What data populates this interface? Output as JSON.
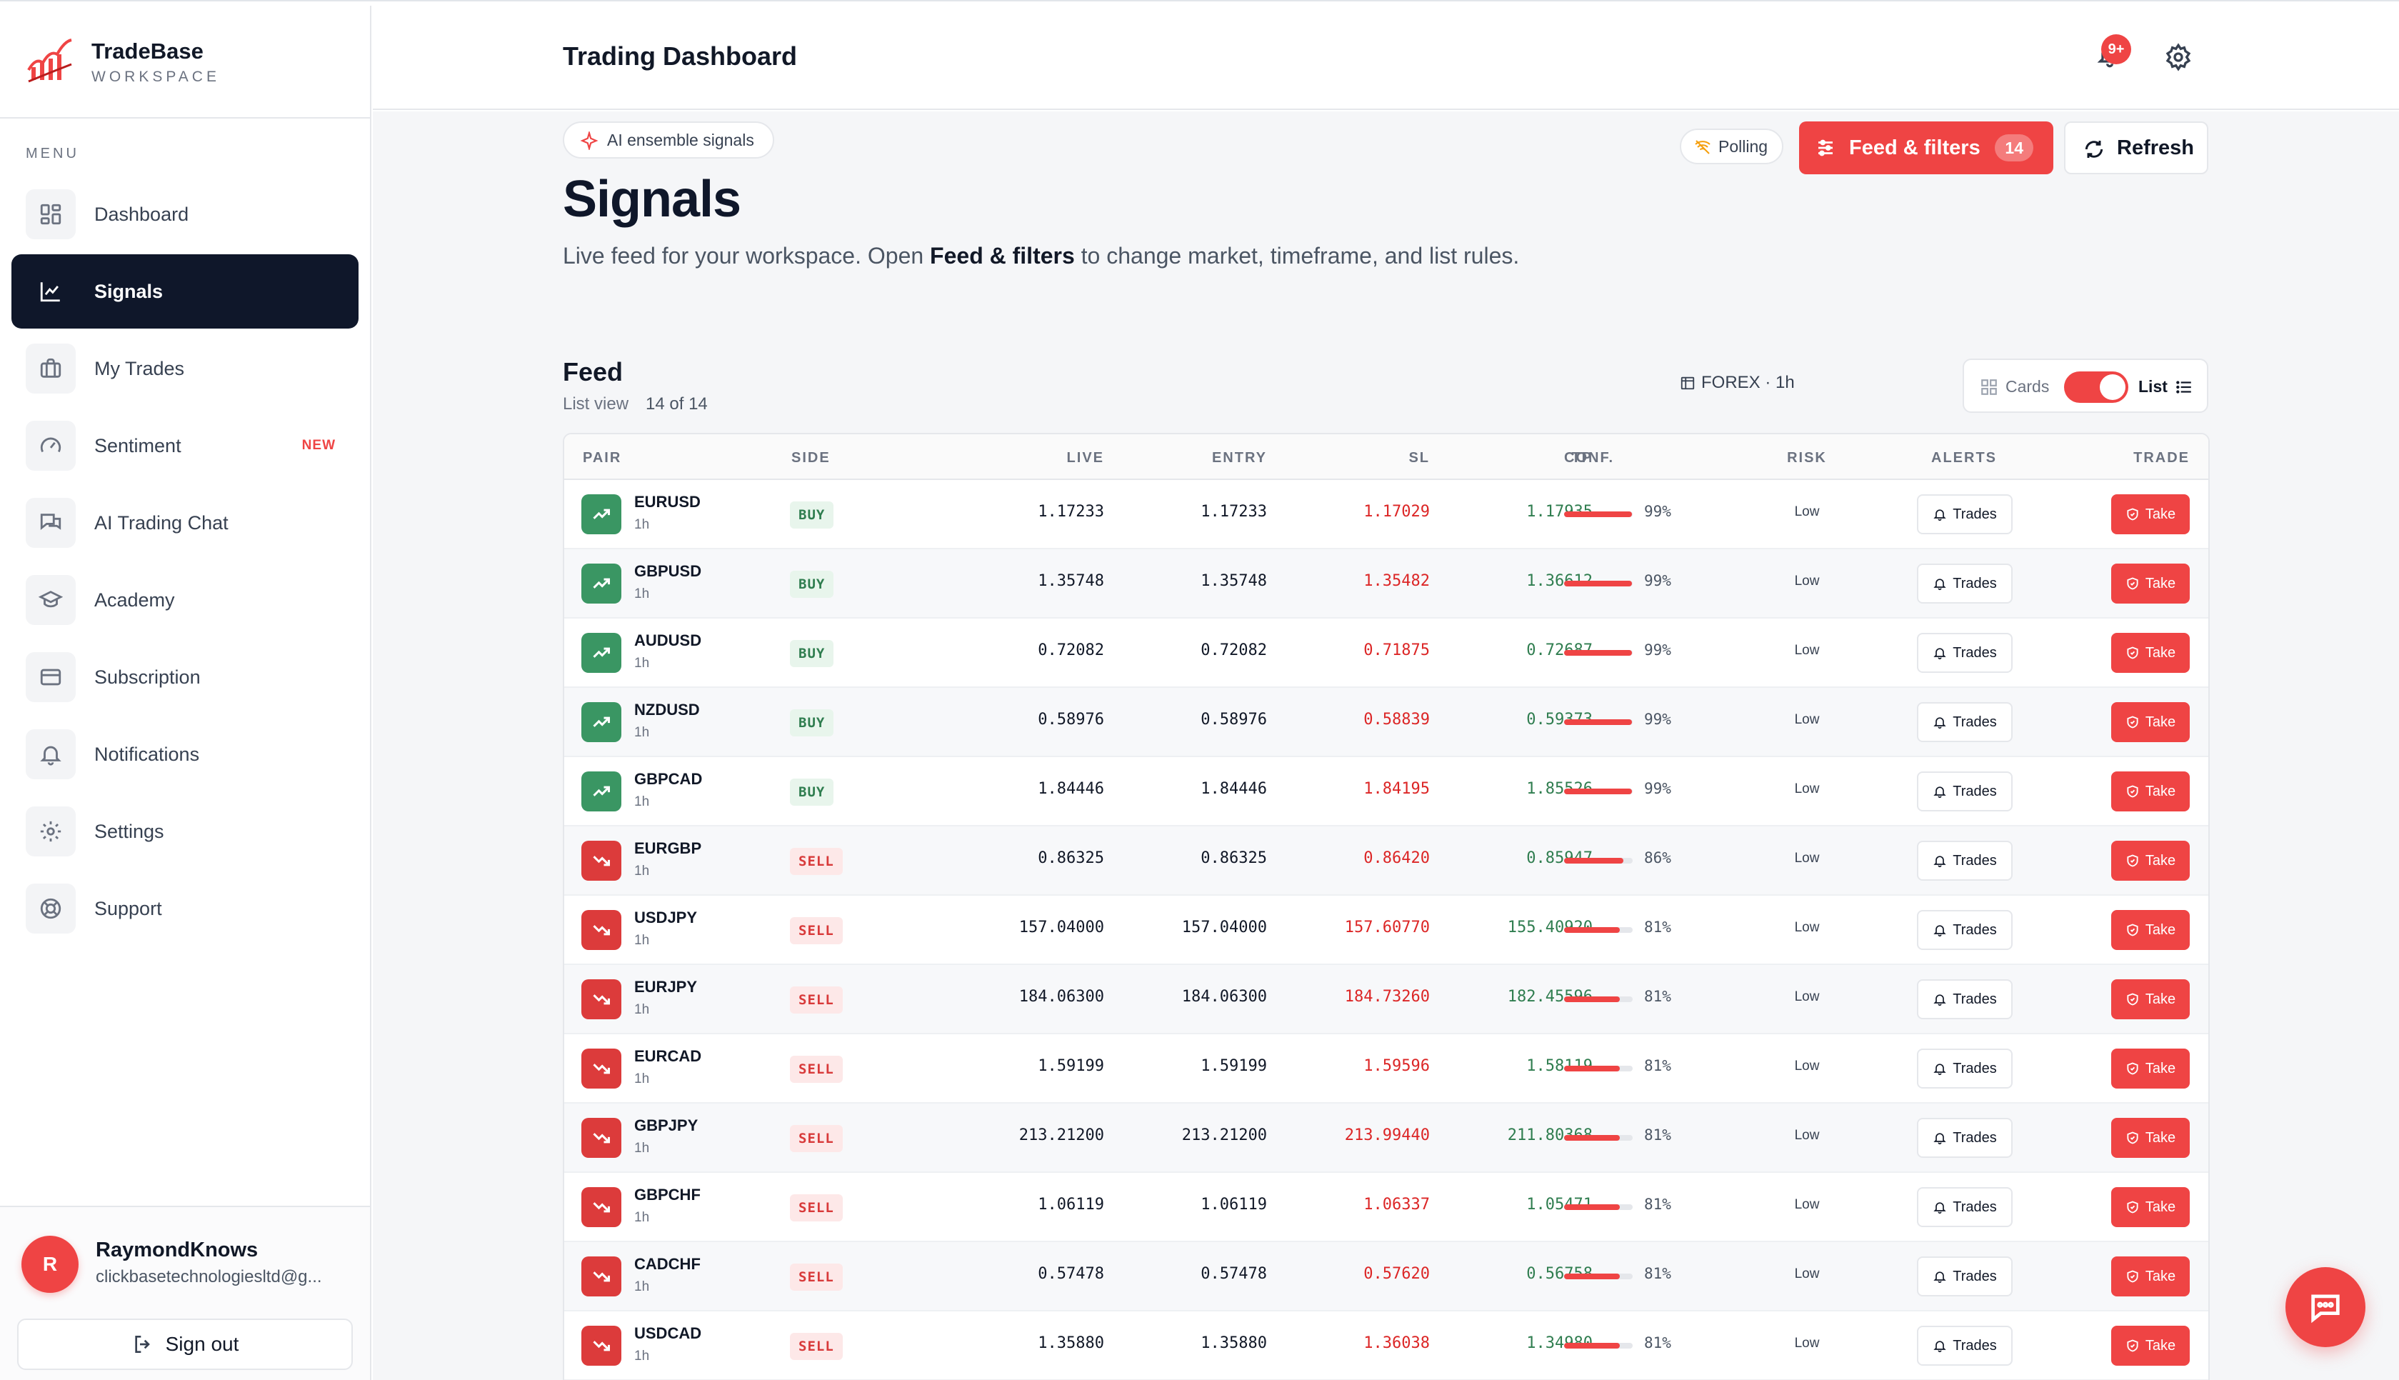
{
  "brand": {
    "name": "TradeBase",
    "subtitle": "WORKSPACE"
  },
  "sidebar": {
    "menu_label": "MENU",
    "items": [
      {
        "label": "Dashboard",
        "icon": "grid-icon",
        "active": false,
        "badge": ""
      },
      {
        "label": "Signals",
        "icon": "chart-line-icon",
        "active": true,
        "badge": ""
      },
      {
        "label": "My Trades",
        "icon": "briefcase-icon",
        "active": false,
        "badge": ""
      },
      {
        "label": "Sentiment",
        "icon": "gauge-icon",
        "active": false,
        "badge": "NEW"
      },
      {
        "label": "AI Trading Chat",
        "icon": "chat-icon",
        "active": false,
        "badge": ""
      },
      {
        "label": "Academy",
        "icon": "graduation-cap-icon",
        "active": false,
        "badge": ""
      },
      {
        "label": "Subscription",
        "icon": "credit-card-icon",
        "active": false,
        "badge": ""
      },
      {
        "label": "Notifications",
        "icon": "bell-icon",
        "active": false,
        "badge": ""
      },
      {
        "label": "Settings",
        "icon": "gear-icon",
        "active": false,
        "badge": ""
      },
      {
        "label": "Support",
        "icon": "lifebuoy-icon",
        "active": false,
        "badge": ""
      }
    ],
    "user": {
      "initial": "R",
      "name": "RaymondKnows",
      "email": "clickbasetechnologiesltd@g..."
    },
    "signout_label": "Sign out"
  },
  "header": {
    "title": "Trading Dashboard",
    "notification_badge": "9+"
  },
  "main": {
    "chip_label": "AI ensemble signals",
    "title": "Signals",
    "desc_pre": "Live feed for your workspace. Open ",
    "desc_bold": "Feed & filters",
    "desc_post": " to change market, timeframe, and list rules.",
    "polling_label": "Polling",
    "feed_filters_label": "Feed & filters",
    "feed_filters_count": "14",
    "refresh_label": "Refresh"
  },
  "feed": {
    "title": "Feed",
    "view_label": "List view",
    "count_label": "14 of 14",
    "market_label": "FOREX · 1h",
    "toggle_cards": "Cards",
    "toggle_list": "List"
  },
  "table": {
    "columns": [
      "PAIR",
      "SIDE",
      "LIVE",
      "ENTRY",
      "SL",
      "TP",
      "CONF.",
      "RISK",
      "ALERTS",
      "TRADE"
    ],
    "alert_label": "Trades",
    "take_label": "Take",
    "rows": [
      {
        "pair": "EURUSD",
        "tf": "1h",
        "side": "BUY",
        "live": "1.17233",
        "entry": "1.17233",
        "sl": "1.17029",
        "tp": "1.17935",
        "conf": "99%",
        "conf_value": 0.99,
        "risk": "Low"
      },
      {
        "pair": "GBPUSD",
        "tf": "1h",
        "side": "BUY",
        "live": "1.35748",
        "entry": "1.35748",
        "sl": "1.35482",
        "tp": "1.36612",
        "conf": "99%",
        "conf_value": 0.99,
        "risk": "Low"
      },
      {
        "pair": "AUDUSD",
        "tf": "1h",
        "side": "BUY",
        "live": "0.72082",
        "entry": "0.72082",
        "sl": "0.71875",
        "tp": "0.72687",
        "conf": "99%",
        "conf_value": 0.99,
        "risk": "Low"
      },
      {
        "pair": "NZDUSD",
        "tf": "1h",
        "side": "BUY",
        "live": "0.58976",
        "entry": "0.58976",
        "sl": "0.58839",
        "tp": "0.59373",
        "conf": "99%",
        "conf_value": 0.99,
        "risk": "Low"
      },
      {
        "pair": "GBPCAD",
        "tf": "1h",
        "side": "BUY",
        "live": "1.84446",
        "entry": "1.84446",
        "sl": "1.84195",
        "tp": "1.85526",
        "conf": "99%",
        "conf_value": 0.99,
        "risk": "Low"
      },
      {
        "pair": "EURGBP",
        "tf": "1h",
        "side": "SELL",
        "live": "0.86325",
        "entry": "0.86325",
        "sl": "0.86420",
        "tp": "0.85947",
        "conf": "86%",
        "conf_value": 0.86,
        "risk": "Low"
      },
      {
        "pair": "USDJPY",
        "tf": "1h",
        "side": "SELL",
        "live": "157.04000",
        "entry": "157.04000",
        "sl": "157.60770",
        "tp": "155.40920",
        "conf": "81%",
        "conf_value": 0.81,
        "risk": "Low"
      },
      {
        "pair": "EURJPY",
        "tf": "1h",
        "side": "SELL",
        "live": "184.06300",
        "entry": "184.06300",
        "sl": "184.73260",
        "tp": "182.45596",
        "conf": "81%",
        "conf_value": 0.81,
        "risk": "Low"
      },
      {
        "pair": "EURCAD",
        "tf": "1h",
        "side": "SELL",
        "live": "1.59199",
        "entry": "1.59199",
        "sl": "1.59596",
        "tp": "1.58119",
        "conf": "81%",
        "conf_value": 0.81,
        "risk": "Low"
      },
      {
        "pair": "GBPJPY",
        "tf": "1h",
        "side": "SELL",
        "live": "213.21200",
        "entry": "213.21200",
        "sl": "213.99440",
        "tp": "211.80368",
        "conf": "81%",
        "conf_value": 0.81,
        "risk": "Low"
      },
      {
        "pair": "GBPCHF",
        "tf": "1h",
        "side": "SELL",
        "live": "1.06119",
        "entry": "1.06119",
        "sl": "1.06337",
        "tp": "1.05471",
        "conf": "81%",
        "conf_value": 0.81,
        "risk": "Low"
      },
      {
        "pair": "CADCHF",
        "tf": "1h",
        "side": "SELL",
        "live": "0.57478",
        "entry": "0.57478",
        "sl": "0.57620",
        "tp": "0.56758",
        "conf": "81%",
        "conf_value": 0.81,
        "risk": "Low"
      },
      {
        "pair": "USDCAD",
        "tf": "1h",
        "side": "SELL",
        "live": "1.35880",
        "entry": "1.35880",
        "sl": "1.36038",
        "tp": "1.34980",
        "conf": "81%",
        "conf_value": 0.81,
        "risk": "Low"
      }
    ]
  },
  "colors": {
    "accent": "#ef4444",
    "buy": "#3a9663",
    "sell": "#dc3b3b",
    "nav_active": "#0f172a"
  }
}
